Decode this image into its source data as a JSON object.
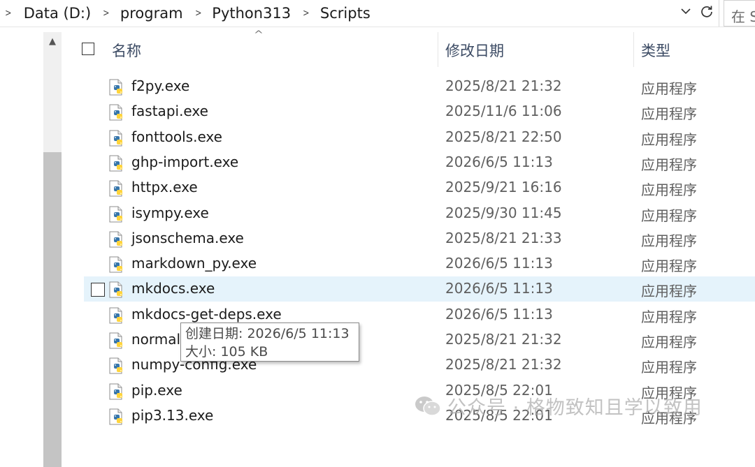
{
  "address_bar": {
    "crumbs": [
      "Data (D:)",
      "program",
      "Python313",
      "Scripts"
    ],
    "search_placeholder": "在 S"
  },
  "columns": {
    "name": "名称",
    "date_modified": "修改日期",
    "type": "类型"
  },
  "files": [
    {
      "name": "f2py.exe",
      "date": "2025/8/21 21:32",
      "type": "应用程序"
    },
    {
      "name": "fastapi.exe",
      "date": "2025/11/6 11:06",
      "type": "应用程序"
    },
    {
      "name": "fonttools.exe",
      "date": "2025/8/21 22:50",
      "type": "应用程序"
    },
    {
      "name": "ghp-import.exe",
      "date": "2026/6/5 11:13",
      "type": "应用程序"
    },
    {
      "name": "httpx.exe",
      "date": "2025/9/21 16:16",
      "type": "应用程序"
    },
    {
      "name": "isympy.exe",
      "date": "2025/9/30 11:45",
      "type": "应用程序"
    },
    {
      "name": "jsonschema.exe",
      "date": "2025/8/21 21:33",
      "type": "应用程序"
    },
    {
      "name": "markdown_py.exe",
      "date": "2026/6/5 11:13",
      "type": "应用程序"
    },
    {
      "name": "mkdocs.exe",
      "date": "2026/6/5 11:13",
      "type": "应用程序"
    },
    {
      "name": "mkdocs-get-deps.exe",
      "date": "2026/6/5 11:13",
      "type": "应用程序"
    },
    {
      "name": "normal",
      "date": "2025/8/21 21:32",
      "type": "应用程序"
    },
    {
      "name": "numpy-config.exe",
      "date": "2025/8/21 21:32",
      "type": "应用程序"
    },
    {
      "name": "pip.exe",
      "date": "2025/8/5 22:01",
      "type": "应用程序"
    },
    {
      "name": "pip3.13.exe",
      "date": "2025/8/5 22:01",
      "type": "应用程序"
    }
  ],
  "hovered_row": "mkdocs.exe",
  "tooltip": {
    "created": "创建日期: 2026/6/5 11:13",
    "size": "大小: 105 KB"
  },
  "watermark": {
    "text": "公众号 · 格物致知且学以致用"
  },
  "icons": {
    "file": "python-executable-icon",
    "dropdown": "chevron-down-icon",
    "refresh": "refresh-icon"
  },
  "colors": {
    "hover_row": "#e5f3fb",
    "header_text": "#3c4b64",
    "secondary_text": "#5f5f5f"
  }
}
